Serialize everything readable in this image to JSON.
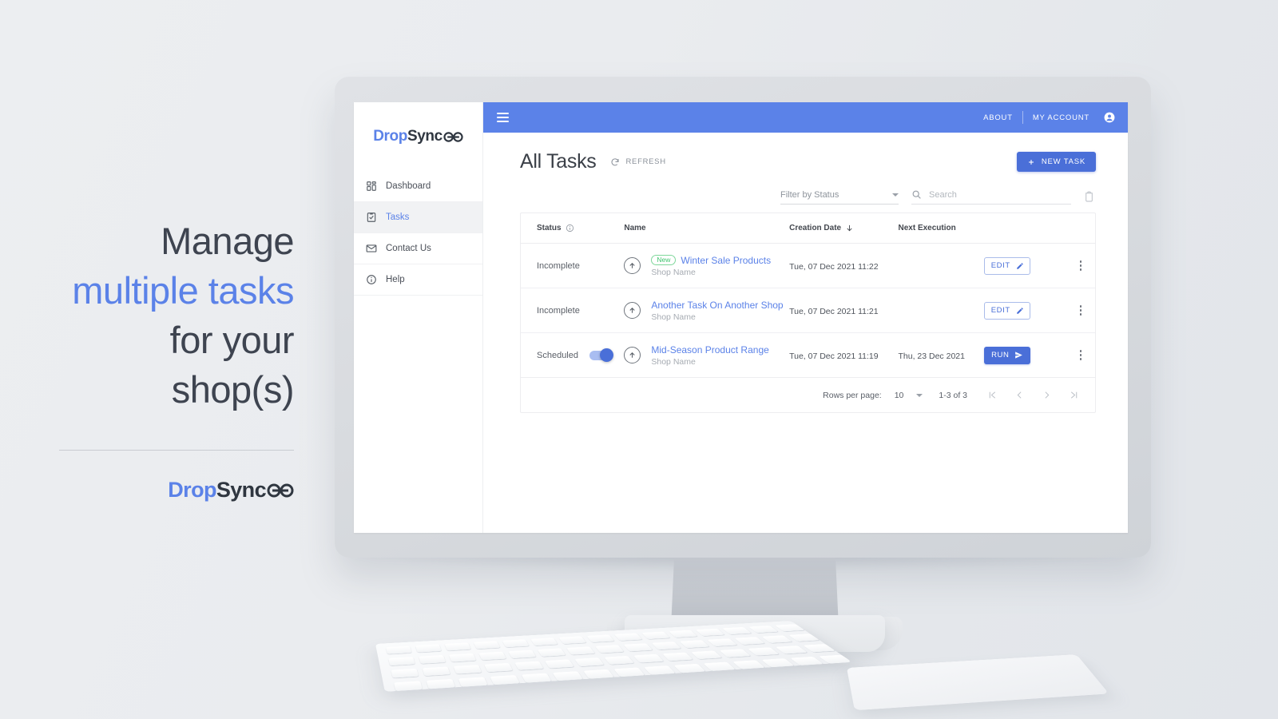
{
  "promo": {
    "line1": "Manage",
    "highlight": "multiple tasks",
    "line3": "for  your",
    "line4": "shop(s)",
    "logo_drop": "Drop",
    "logo_sync": "Sync",
    "logo_mark_name": "infinity-mark"
  },
  "brand": {
    "accent": "#5b82e8",
    "button_blue": "#4a6fd8",
    "green": "#3ec46d",
    "logo_drop": "Drop",
    "logo_sync": "Sync"
  },
  "appbar": {
    "menu_icon": "hamburger-icon",
    "about_label": "ABOUT",
    "account_label": "MY ACCOUNT",
    "account_icon": "account-circle-icon"
  },
  "sidebar": {
    "items": [
      {
        "label": "Dashboard",
        "icon": "dashboard-icon",
        "active": false
      },
      {
        "label": "Tasks",
        "icon": "tasks-checklist-icon",
        "active": true
      },
      {
        "label": "Contact Us",
        "icon": "mail-icon",
        "active": false
      },
      {
        "label": "Help",
        "icon": "info-circle-icon",
        "active": false
      }
    ]
  },
  "page": {
    "title": "All Tasks",
    "refresh_label": "REFRESH",
    "refresh_icon": "refresh-icon",
    "new_task_label": "NEW TASK",
    "new_task_icon": "plus-icon"
  },
  "filters": {
    "status_label": "Filter by Status",
    "status_options": [
      "Filter by Status"
    ],
    "search_placeholder": "Search",
    "search_value": "",
    "search_icon": "search-icon",
    "delete_icon": "trash-icon"
  },
  "table": {
    "columns": [
      {
        "key": "status",
        "label": "Status",
        "icon": "info-circle-icon"
      },
      {
        "key": "name",
        "label": "Name"
      },
      {
        "key": "creation_date",
        "label": "Creation Date",
        "sort": "desc",
        "sort_icon": "arrow-down-icon"
      },
      {
        "key": "next_execution",
        "label": "Next Execution"
      },
      {
        "key": "action",
        "label": ""
      },
      {
        "key": "menu",
        "label": ""
      }
    ],
    "rows": [
      {
        "status": "Incomplete",
        "has_toggle": false,
        "toggle_on": false,
        "badge": "New",
        "name": "Winter Sale Products",
        "shop": "Shop Name",
        "creation_date": "Tue, 07 Dec 2021 11:22",
        "next_execution": "",
        "action_label": "EDIT",
        "action_type": "edit",
        "action_icon": "pencil-icon",
        "row_icon": "upload-circle-icon",
        "menu_icon": "kebab-menu-icon"
      },
      {
        "status": "Incomplete",
        "has_toggle": false,
        "toggle_on": false,
        "badge": "",
        "name": "Another Task On Another Shop",
        "shop": "Shop Name",
        "creation_date": "Tue, 07 Dec 2021 11:21",
        "next_execution": "",
        "action_label": "EDIT",
        "action_type": "edit",
        "action_icon": "pencil-icon",
        "row_icon": "upload-circle-icon",
        "menu_icon": "kebab-menu-icon"
      },
      {
        "status": "Scheduled",
        "has_toggle": true,
        "toggle_on": true,
        "badge": "",
        "name": "Mid-Season Product Range",
        "shop": "Shop Name",
        "creation_date": "Tue, 07 Dec 2021 11:19",
        "next_execution": "Thu, 23 Dec 2021",
        "action_label": "RUN",
        "action_type": "run",
        "action_icon": "send-icon",
        "row_icon": "upload-circle-icon",
        "menu_icon": "kebab-menu-icon"
      }
    ]
  },
  "paginator": {
    "rows_per_page_label": "Rows per page:",
    "rows_per_page_value": "10",
    "rows_per_page_options": [
      "10"
    ],
    "range_label": "1-3 of 3",
    "first_icon": "first-page-icon",
    "prev_icon": "chevron-left-icon",
    "next_icon": "chevron-right-icon",
    "last_icon": "last-page-icon"
  }
}
